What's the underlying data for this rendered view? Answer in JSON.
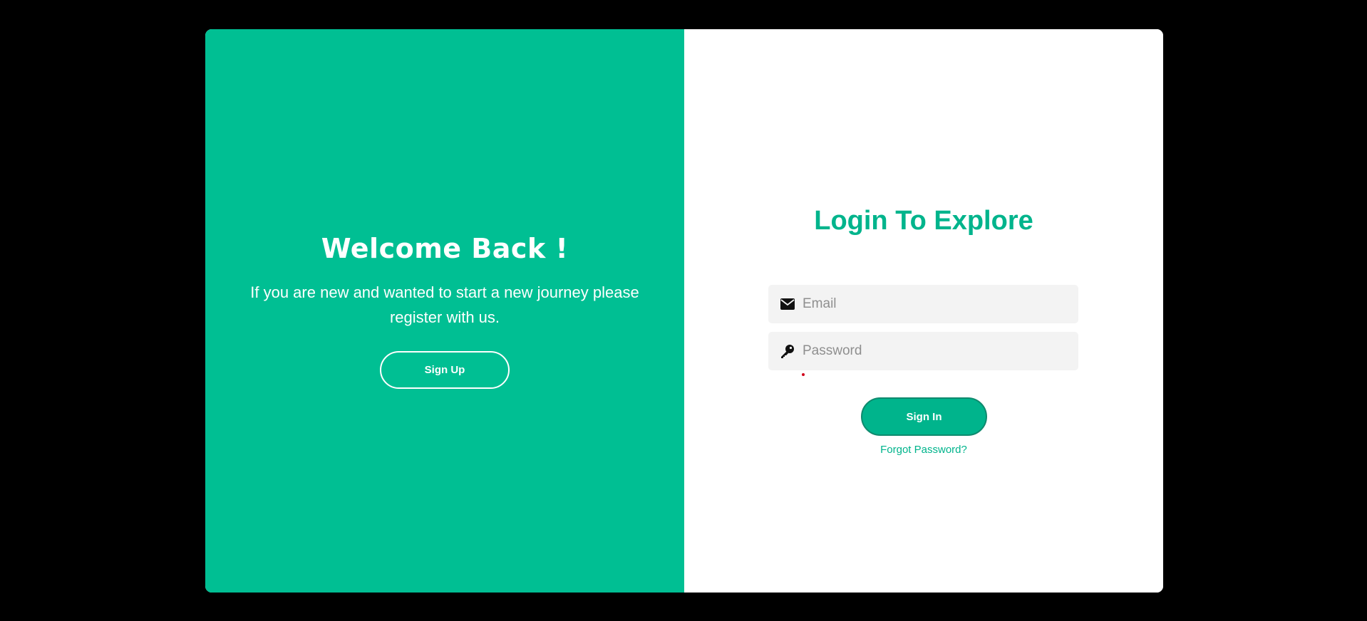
{
  "welcome": {
    "title": "Welcome Back !",
    "text": "If you are new and wanted to start a new journey please register with us.",
    "signup_label": "Sign Up"
  },
  "login": {
    "title": "Login To Explore",
    "email": {
      "placeholder": "Email",
      "value": "",
      "icon": "envelope-icon"
    },
    "password": {
      "placeholder": "Password",
      "value": "",
      "icon": "key-icon"
    },
    "signin_label": "Sign In",
    "forgot_label": "Forgot Password?"
  },
  "colors": {
    "accent": "#00bf93",
    "accent_dark": "#00b48c",
    "background": "#000000",
    "input_bg": "#f3f3f3",
    "error": "#d0021b"
  }
}
